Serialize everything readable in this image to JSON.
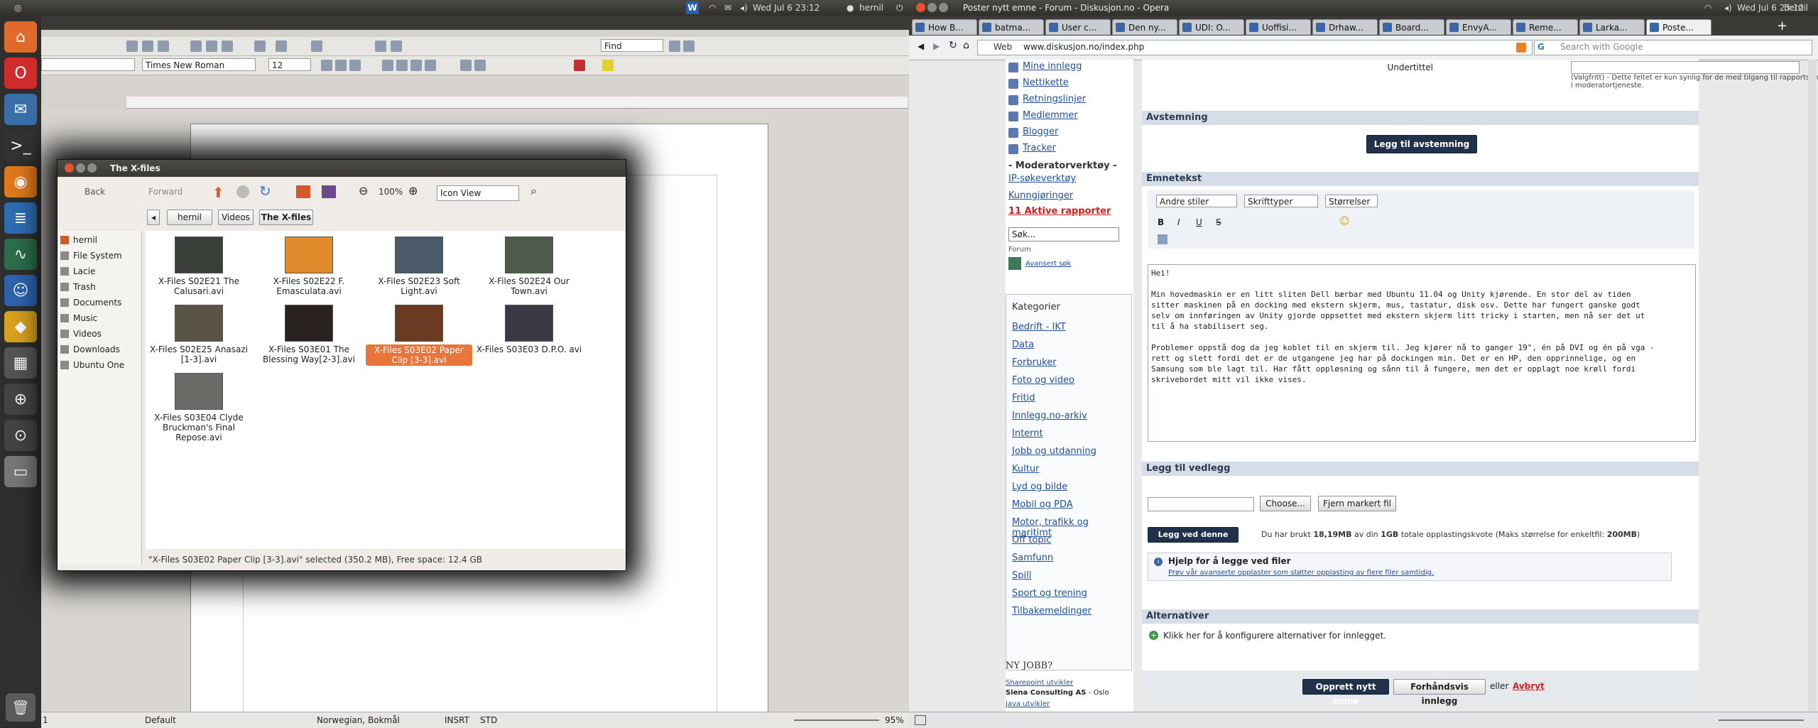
{
  "left_panel": {
    "time": "Wed Jul  6 23:12",
    "user": "hernil"
  },
  "launcher": [
    {
      "label": "Home Folder",
      "icon": "home-folder-icon",
      "color": "#e06a2c",
      "glyph": "⌂"
    },
    {
      "label": "Opera",
      "icon": "opera-icon",
      "color": "#d12b2b",
      "glyph": "O"
    },
    {
      "label": "Thunderbird Mail/News",
      "icon": "thunderbird-icon",
      "color": "#3a6ea8",
      "glyph": "✉"
    },
    {
      "label": "Terminal",
      "icon": "terminal-icon",
      "color": "#333333",
      "glyph": ">_"
    },
    {
      "label": "Firefox Web Browser",
      "icon": "firefox-icon",
      "color": "#e07a1c",
      "glyph": "◉"
    },
    {
      "label": "LibreOffice Writer",
      "icon": "libreoffice-writer-icon",
      "color": "#2e6db5",
      "glyph": "≣"
    },
    {
      "label": "System Monitor",
      "icon": "system-monitor-icon",
      "color": "#2a6e4a",
      "glyph": "∿"
    },
    {
      "label": "Empathy Internet Messaging",
      "icon": "empathy-icon",
      "color": "#2d63b0",
      "glyph": "☺"
    },
    {
      "label": "Geany",
      "icon": "geany-icon",
      "color": "#d9a21e",
      "glyph": "◆"
    },
    {
      "label": "Workspace Switcher",
      "icon": "workspace-switcher-icon",
      "color": "#555555",
      "glyph": "▦"
    },
    {
      "label": "Applications",
      "icon": "applications-icon",
      "color": "#444444",
      "glyph": "⊕"
    },
    {
      "label": "Files & Folders",
      "icon": "files-folders-icon",
      "color": "#444444",
      "glyph": "⊙"
    },
    {
      "label": "Lacie",
      "icon": "lacie-drive-icon",
      "color": "#777777",
      "glyph": "▭"
    }
  ],
  "writer": {
    "find_placeholder": "Find",
    "font_name": "Times New Roman",
    "font_size": "12",
    "status": {
      "page": "1",
      "style": "Default",
      "language": "Norwegian, Bokmål",
      "insert": "INSRT",
      "std": "STD",
      "zoom": "95%"
    }
  },
  "file_manager": {
    "title": "The X-files",
    "back": "Back",
    "forward": "Forward",
    "zoom": "100%",
    "view": "Icon View",
    "path": [
      "hernil",
      "Videos",
      "The X-files"
    ],
    "sidebar": [
      "hernil",
      "File System",
      "Lacie",
      "Trash",
      "Documents",
      "Music",
      "Videos",
      "Downloads",
      "Ubuntu One"
    ],
    "files": [
      {
        "name": "X-Files S02E21 The Calusari.avi",
        "color": "#3a3f3a"
      },
      {
        "name": "X-Files S02E22 F. Emasculata.avi",
        "color": "#e08a2c"
      },
      {
        "name": "X-Files S02E23 Soft Light.avi",
        "color": "#4a5a6a"
      },
      {
        "name": "X-Files S02E24 Our Town.avi",
        "color": "#4e5a4a"
      },
      {
        "name": "X-Files S02E25 Anasazi [1-3].avi",
        "color": "#5a5448"
      },
      {
        "name": "X-Files S03E01 The Blessing Way[2-3].avi",
        "color": "#2a2220"
      },
      {
        "name": "X-Files S03E02 Paper Clip [3-3].avi",
        "color": "#6a3a22"
      },
      {
        "name": "X-Files S03E03 D.P.O. avi",
        "color": "#3a3a44"
      },
      {
        "name": "X-Files S03E04 Clyde Bruckman's Final Repose.avi",
        "color": "#6a6a66"
      }
    ],
    "selected_index": 6,
    "status": "\"X-Files S03E02 Paper Clip [3-3].avi\" selected (350.2 MB), Free space: 12.4 GB"
  },
  "opera": {
    "window_title": "Poster nytt emne - Forum - Diskusjon.no - Opera",
    "panel_time": "Wed Jul  6 23:12",
    "panel_user": "hernil",
    "tabs": [
      "How B...",
      "batma...",
      "User c...",
      "Den ny...",
      "UDI: O...",
      "Uoffisi...",
      "Drhaw...",
      "Board...",
      "EnvyA...",
      "Reme...",
      "Larka...",
      "Poste..."
    ],
    "address_label": "Web",
    "url": "www.diskusjon.no/index.php",
    "search_placeholder": "Search with Google",
    "sidebar_links": [
      "Mine innlegg",
      "Nettikette",
      "Retningslinjer",
      "Medlemmer",
      "Blogger",
      "Tracker"
    ],
    "moderator_title": "- Moderatorverktøy -",
    "moderator_links": [
      "IP-søkeverktøy",
      "Kunngjøringer"
    ],
    "reports": "11 Aktive rapporter",
    "search_box": "Søk...",
    "forum_label": "Forum",
    "advanced_search": "Avansert søk",
    "categories_title": "Kategorier",
    "categories": [
      "Bedrift - IKT",
      "Data",
      "Forbruker",
      "Foto og video",
      "Fritid",
      "Innlegg.no-arkiv",
      "Internt",
      "Jobb og utdanning",
      "Kultur",
      "Lyd og bilde",
      "Mobil og PDA",
      "Motor, trafikk og maritimt",
      "Off topic",
      "Samfunn",
      "Spill",
      "Sport og trening",
      "Tilbakemeldinger"
    ],
    "nyjobb": "NY JOBB?",
    "job_link": "Sharepoint utvikler",
    "job_company": "Siena Consulting AS",
    "job_location": "- Oslo",
    "job_link2": "Java utvikler",
    "subtitle_label": "Undertittel",
    "subtitle_help": "(Valgfritt) - Dette feltet er kun synlig for de med tilgang til rapportsenter. Skal kun brukes i moderatortjeneste.",
    "poll_title": "Avstemning",
    "poll_button": "Legg til avstemning",
    "content_title": "Emnetekst",
    "editor_selects": [
      "Andre stiler",
      "Skrifttyper",
      "Størrelser"
    ],
    "body": [
      "Hei!",
      "",
      "Min hovedmaskin er en litt sliten Dell bærbar med Ubuntu 11.04 og Unity kjørende. En stor del av tiden",
      "sitter maskinen på en docking med ekstern skjerm, mus, tastatur, disk osv. Dette har fungert ganske godt",
      "selv om innføringen av Unity gjorde oppsettet med ekstern skjerm litt tricky i starten, men nå ser det ut",
      "til å ha stabilisert seg.",
      "",
      "Problemer oppstå dog da jeg koblet til en skjerm til. Jeg kjører nå to ganger 19\", én på DVI og én på vga -",
      "rett og slett fordi det er de utgangene jeg har på dockingen min. Det er en HP, den opprinnelige, og en",
      "Samsung som ble lagt til. Har fått oppløsning og sånn til å fungere, men det er opplagt noe krøll fordi",
      "skrivebordet mitt vil ikke vises."
    ],
    "attach_title": "Legg til vedlegg",
    "choose_button": "Choose...",
    "remove_button": "Fjern markert fil",
    "add_file_button": "Legg ved denne filen",
    "quota_pre": "Du har brukt",
    "quota_used": "18,19MB",
    "quota_mid": "av din",
    "quota_total": "1GB",
    "quota_post": "totale opplastingskvote (Maks størrelse for enkeltfil:",
    "quota_max": "200MB",
    "quota_end": ")",
    "help_title": "Hjelp for å legge ved filer",
    "help_link": "Prøv vår avanserte opplaster som støtter opplasting av flere filer samtidig.",
    "options_title": "Alternativer",
    "options_text": "Klikk her for å konfigurere alternativer for innlegget.",
    "submit_button": "Opprett nytt emne",
    "preview_button": "Forhåndsvis innlegg",
    "or_text": "eller",
    "cancel_link": "Avbryt"
  },
  "colors": {
    "accent_orange": "#e8753a",
    "forum_dark": "#22314a",
    "report_red": "#cc2222"
  }
}
